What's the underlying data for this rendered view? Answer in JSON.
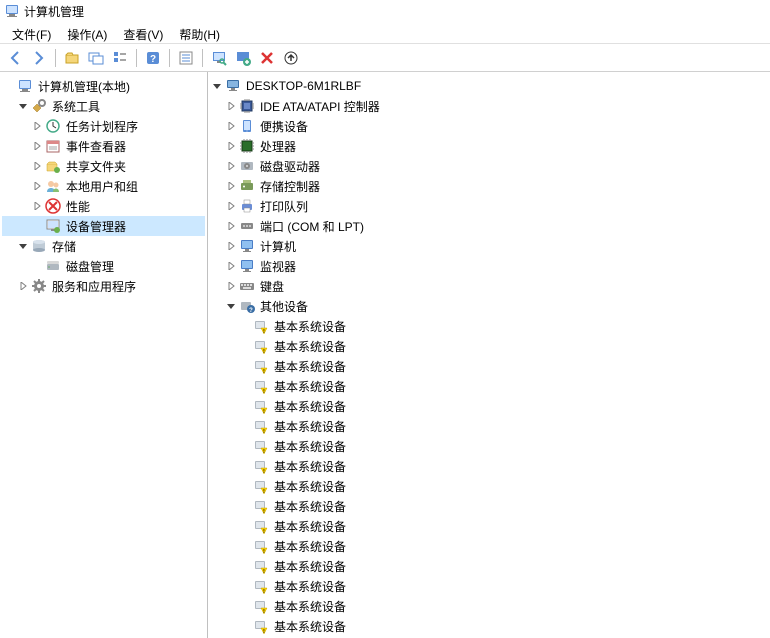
{
  "window": {
    "title": "计算机管理"
  },
  "menu": {
    "file": "文件(F)",
    "action": "操作(A)",
    "view": "查看(V)",
    "help": "帮助(H)"
  },
  "left_tree": {
    "root": "计算机管理(本地)",
    "system_tools": "系统工具",
    "task_scheduler": "任务计划程序",
    "event_viewer": "事件查看器",
    "shared_folders": "共享文件夹",
    "local_users": "本地用户和组",
    "performance": "性能",
    "device_manager": "设备管理器",
    "storage": "存储",
    "disk_management": "磁盘管理",
    "services_apps": "服务和应用程序"
  },
  "right_tree": {
    "computer_name": "DESKTOP-6M1RLBF",
    "ide_atapi": "IDE ATA/ATAPI 控制器",
    "portable": "便携设备",
    "processor": "处理器",
    "disk_drives": "磁盘驱动器",
    "storage_ctrl": "存储控制器",
    "print_queue": "打印队列",
    "ports": "端口 (COM 和 LPT)",
    "computer": "计算机",
    "monitor": "监视器",
    "keyboard": "键盘",
    "other_devices": "其他设备",
    "base_system_device": "基本系统设备"
  },
  "unknown_device_count": 16
}
